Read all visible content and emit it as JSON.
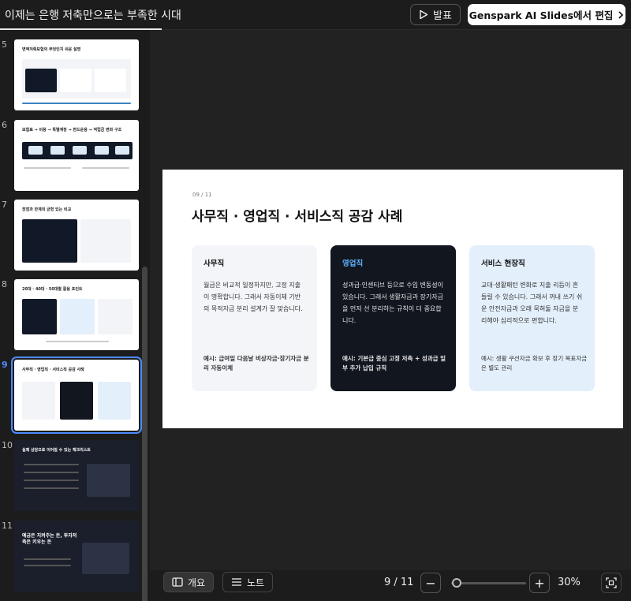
{
  "header": {
    "doc_title": "이제는 은행 저축만으로는 부족한 시대",
    "present_label": "발표",
    "edit_label": "Genspark AI Slides에서 편집"
  },
  "sidebar": {
    "thumbnails": [
      {
        "number": "5",
        "title": "변액저축보험의 무엇인지 쉬운 설명"
      },
      {
        "number": "6",
        "title": "보험료 → 비용 → 특별계정 → 펀드운용 → 적립금 변화 구조"
      },
      {
        "number": "7",
        "title": "장점과 한계의 균형 있는 비교"
      },
      {
        "number": "8",
        "title": "20대 · 40대 · 50대별 활용 포인트"
      },
      {
        "number": "9",
        "title": "사무직 · 영업직 · 서비스직 공감 사례"
      },
      {
        "number": "10",
        "title": "실제 상담으로 이어질 수 있는 체크리스트"
      },
      {
        "number": "11",
        "title": "예금은 지켜주는 돈, 투자저축은 키우는 돈"
      }
    ]
  },
  "slide": {
    "page_label": "09 / 11",
    "title": "사무직 · 영업직 · 서비스직 공감 사례",
    "cards": [
      {
        "heading": "사무직",
        "body": "월급은 비교적 일정하지만, 고정 지출이 명확합니다. 그래서 자동이체 기반의 목적자금 분리 설계가 잘 맞습니다.",
        "example": "예시: 급여일 다음날 비상자금·장기자금 분리 자동이체"
      },
      {
        "heading": "영업직",
        "body": "성과급·인센티브 등으로 수입 변동성이 있습니다. 그래서 생활자금과 장기자금을 먼저 선 분리하는 규칙이 더 중요합니다.",
        "example": "예시: 기본급 중심 고정 저축 + 성과급 일부 추가 납입 규칙"
      },
      {
        "heading": "서비스 현장직",
        "body": "교대·생활패턴 변화로 지출 리듬이 흔들릴 수 있습니다. 그래서 꺼내 쓰기 쉬운 안전자금과 오래 묵혀둘 자금을 분리해야 심리적으로 편합니다.",
        "example": "예시: 생활 쿠션자금 확보 후 장기 목표자금은 별도 관리"
      }
    ]
  },
  "footer": {
    "overview_label": "개요",
    "notes_label": "노트",
    "page_indicator": "9 / 11",
    "zoom_level": "30%",
    "zoom_fraction": 0.3
  }
}
